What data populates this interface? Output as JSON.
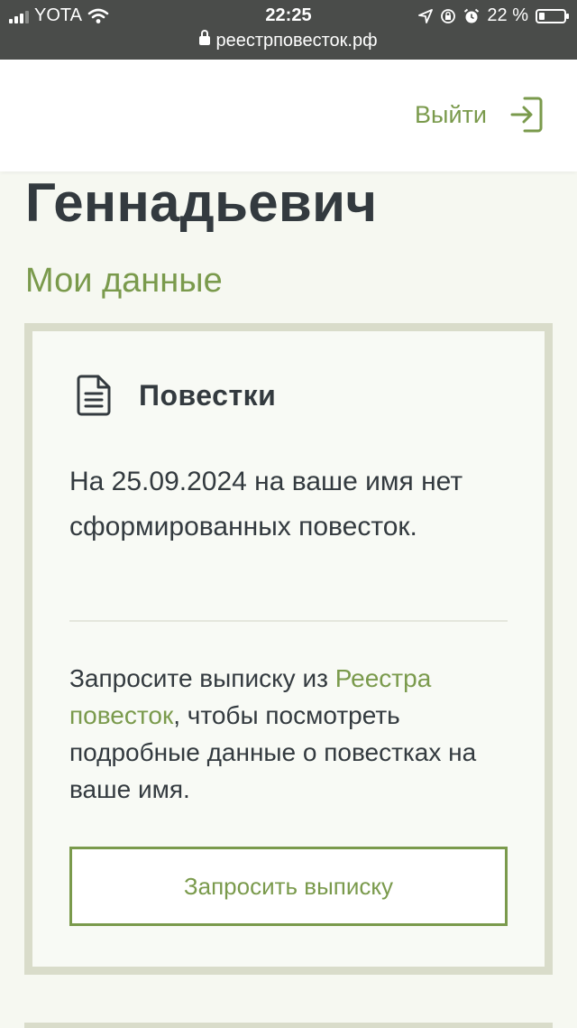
{
  "status_bar": {
    "carrier": "YOTA",
    "time": "22:25",
    "battery_percent": "22 %",
    "battery_level": 0.22,
    "url": "реестрповесток.рф"
  },
  "header": {
    "logout_label": "Выйти"
  },
  "profile": {
    "name": "Геннадьевич",
    "my_data_label": "Мои данные"
  },
  "summons_card": {
    "title": "Повестки",
    "status_text": "На 25.09.2024 на ваше имя нет сформированных повесток.",
    "note_before": "Запросите выписку из ",
    "note_link": "Реестра повесток",
    "note_after": ", чтобы посмотреть подробные данные о повестках на ваше имя.",
    "request_button_label": "Запросить выписку"
  },
  "colors": {
    "accent": "#7a9a4c",
    "text": "#333a3f",
    "card_border": "#d9dcca",
    "page_bg": "#f6f8f1"
  }
}
